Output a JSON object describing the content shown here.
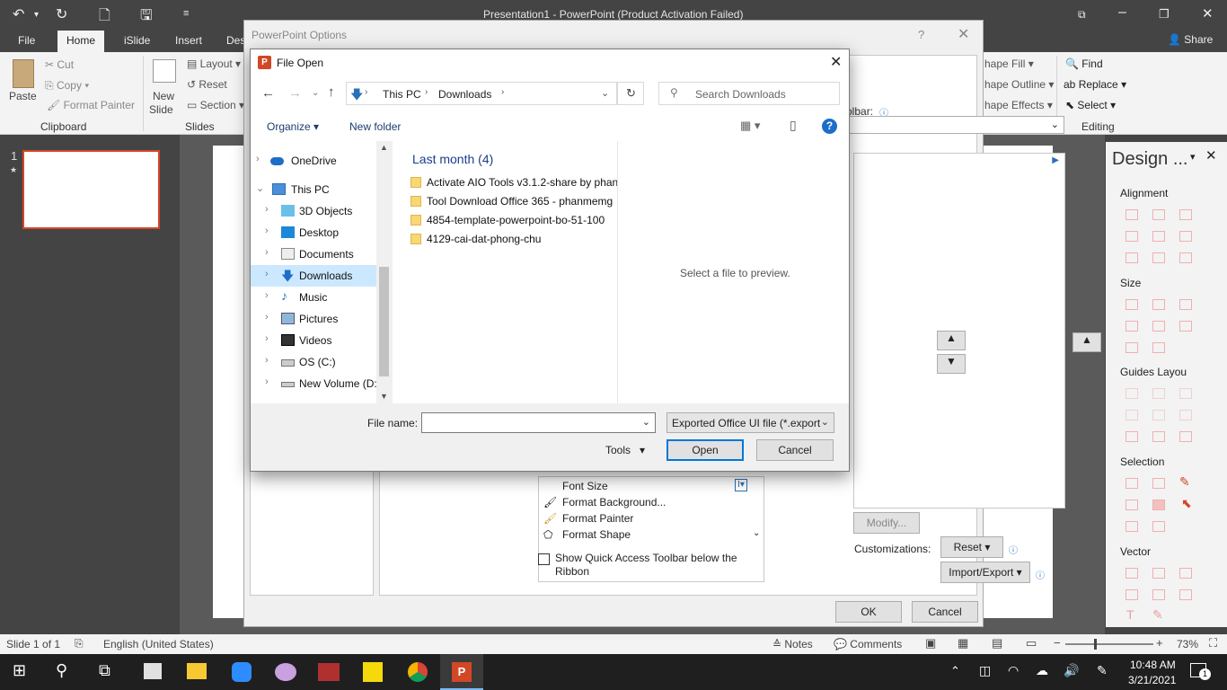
{
  "app": {
    "window_title": "Presentation1  -  PowerPoint (Product Activation Failed)",
    "share_label": "Share"
  },
  "ribbon": {
    "tabs": [
      "File",
      "Home",
      "iSlide",
      "Insert",
      "Des"
    ],
    "clipboard": {
      "paste": "Paste",
      "cut": "Cut",
      "copy": "Copy",
      "format_painter": "Format Painter",
      "group": "Clipboard"
    },
    "slides": {
      "new_slide": "New",
      "new_slide2": "Slide",
      "layout": "Layout",
      "reset": "Reset",
      "section": "Section",
      "group": "Slides"
    },
    "drawing": {
      "shape_fill": "hape Fill",
      "shape_outline": "hape Outline",
      "shape_effects": "hape Effects"
    },
    "editing": {
      "find": "Find",
      "replace": "Replace",
      "select": "Select",
      "group": "Editing"
    }
  },
  "slide_panel": {
    "number": "1",
    "star": "★"
  },
  "options_dialog": {
    "title": "PowerPoint Options",
    "help": "?",
    "toolbar_label": "olbar:",
    "commands": [
      "Font Size",
      "Format Background...",
      "Format Painter",
      "Format Shape"
    ],
    "show_qat_below": "Show Quick Access Toolbar below the",
    "show_qat_below2": "Ribbon",
    "modify": "Modify...",
    "customizations_label": "Customizations:",
    "reset": "Reset",
    "import_export": "Import/Export",
    "ok": "OK",
    "cancel": "Cancel"
  },
  "file_open": {
    "title": "File Open",
    "breadcrumb": [
      "This PC",
      "Downloads"
    ],
    "search_placeholder": "Search Downloads",
    "organize": "Organize",
    "new_folder": "New folder",
    "nav": [
      {
        "label": "OneDrive",
        "icon": "cloud-icon"
      },
      {
        "label": "This PC",
        "icon": "computer-icon"
      },
      {
        "label": "3D Objects",
        "icon": "cube-icon"
      },
      {
        "label": "Desktop",
        "icon": "desktop-icon"
      },
      {
        "label": "Documents",
        "icon": "documents-icon"
      },
      {
        "label": "Downloads",
        "icon": "download-icon"
      },
      {
        "label": "Music",
        "icon": "music-icon"
      },
      {
        "label": "Pictures",
        "icon": "pictures-icon"
      },
      {
        "label": "Videos",
        "icon": "videos-icon"
      },
      {
        "label": "OS (C:)",
        "icon": "drive-icon"
      },
      {
        "label": "New Volume (D:",
        "icon": "drive-icon"
      }
    ],
    "group_header": "Last month (4)",
    "files": [
      "Activate AIO Tools v3.1.2-share by phan",
      "Tool Download Office 365 - phanmemg",
      "4854-template-powerpoint-bo-51-100",
      "4129-cai-dat-phong-chu"
    ],
    "preview_text": "Select a file to preview.",
    "file_name_label": "File name:",
    "file_name_value": "",
    "file_type": "Exported Office UI file (*.export",
    "tools": "Tools",
    "open": "Open",
    "cancel": "Cancel"
  },
  "design_pane": {
    "title": "Design ...",
    "sections": [
      "Alignment",
      "Size",
      "Guides Layou",
      "Selection",
      "Vector"
    ]
  },
  "status": {
    "slide": "Slide 1 of 1",
    "language": "English (United States)",
    "notes": "Notes",
    "comments": "Comments",
    "zoom": "73%"
  },
  "taskbar": {
    "time": "10:48 AM",
    "date": "3/21/2021",
    "notifications": "1"
  }
}
